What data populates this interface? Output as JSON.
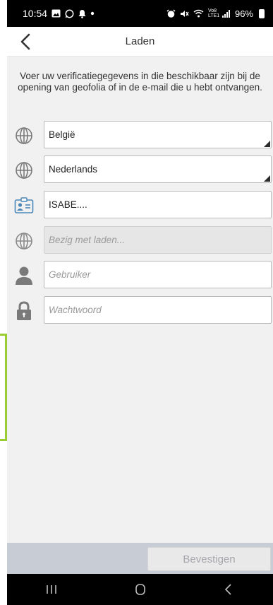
{
  "status_bar": {
    "time": "10:54",
    "signal_label": "Vo8 LTE1",
    "battery": "96%"
  },
  "header": {
    "title": "Laden"
  },
  "instruction": "Voer uw verificatiegegevens in die beschikbaar zijn bij de opening van geofolia of in de e-mail die u hebt ontvangen.",
  "form": {
    "country_value": "België",
    "language_value": "Nederlands",
    "account_value": "ISABE....",
    "server_placeholder": "Bezig met laden...",
    "user_placeholder": "Gebruiker",
    "password_placeholder": "Wachtwoord"
  },
  "footer": {
    "confirm_label": "Bevestigen"
  },
  "colors": {
    "icon_gray": "#7a7a7a",
    "icon_blue": "#4a87b8",
    "accent_green": "#9acd32"
  }
}
